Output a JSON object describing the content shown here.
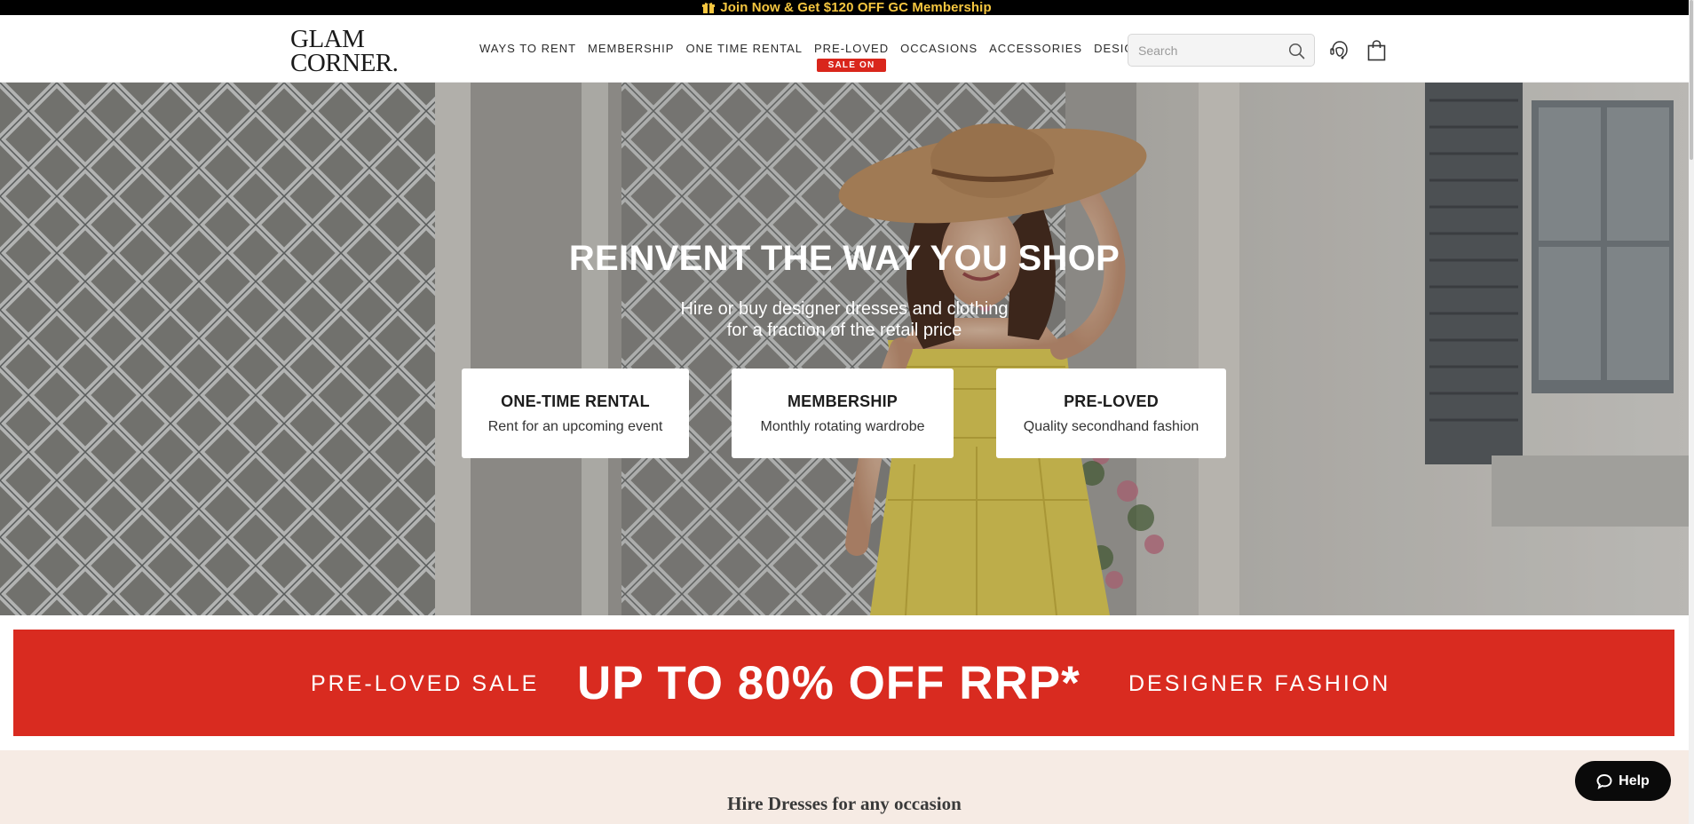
{
  "announcement": {
    "text": "Join Now & Get $120 OFF GC Membership",
    "icon": "gift-icon",
    "text_color": "#f5c640"
  },
  "header": {
    "logo_line1": "GLAM",
    "logo_line2": "CORNER.",
    "nav": [
      {
        "label": "WAYS TO RENT"
      },
      {
        "label": "MEMBERSHIP"
      },
      {
        "label": "ONE TIME RENTAL"
      },
      {
        "label": "PRE-LOVED",
        "badge": "SALE ON"
      },
      {
        "label": "OCCASIONS"
      },
      {
        "label": "ACCESSORIES"
      },
      {
        "label": "DESIGNERS"
      }
    ],
    "search_placeholder": "Search",
    "icons": [
      "search-icon",
      "stylist-chat-icon",
      "shopping-bag-icon"
    ]
  },
  "hero": {
    "title": "REINVENT THE WAY YOU SHOP",
    "subtitle_line1": "Hire or buy designer dresses and clothing",
    "subtitle_line2": "for a fraction of the retail price",
    "cards": [
      {
        "title": "ONE-TIME RENTAL",
        "subtitle": "Rent for an upcoming event"
      },
      {
        "title": "MEMBERSHIP",
        "subtitle": "Monthly rotating wardrobe"
      },
      {
        "title": "PRE-LOVED",
        "subtitle": "Quality secondhand fashion"
      }
    ]
  },
  "promo": {
    "left": "PRE-LOVED SALE",
    "main": "UP TO 80% OFF RRP*",
    "right": "DESIGNER FASHION",
    "background": "#d92b20"
  },
  "occasions": {
    "heading": "Hire Dresses for any occasion",
    "background": "#f6ebe4"
  },
  "help_button": {
    "label": "Help",
    "icon": "chat-bubble-icon"
  }
}
